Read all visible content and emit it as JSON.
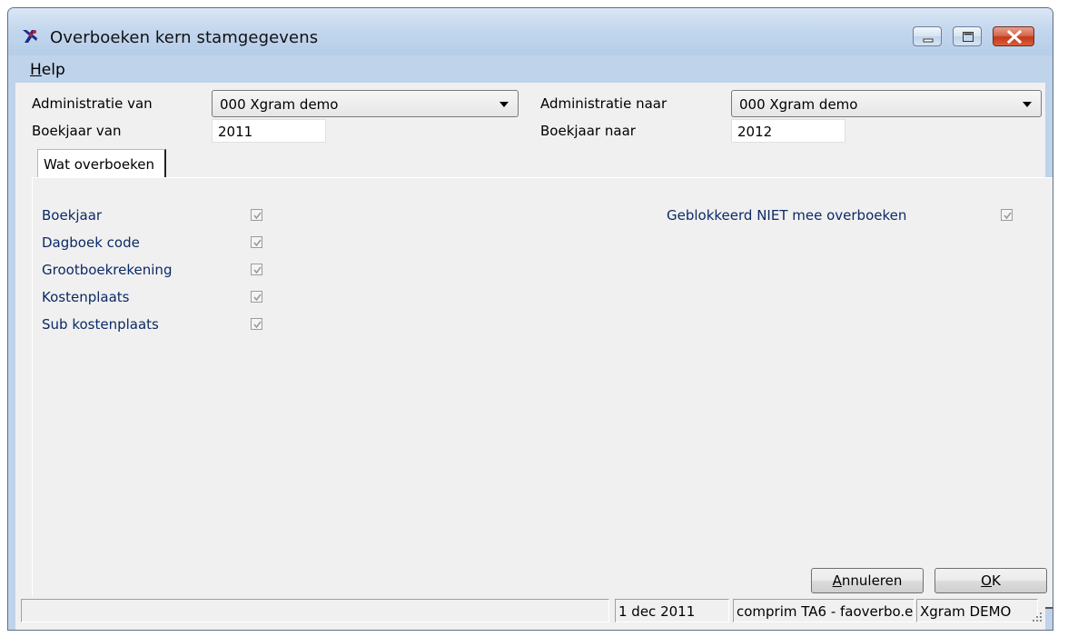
{
  "window": {
    "title": "Overboeken kern stamgegevens",
    "icon": "app-logo-icon"
  },
  "menu": {
    "help_label": "Help",
    "help_mnemonic": "H",
    "help_rest": "elp"
  },
  "form": {
    "admin_from_label": "Administratie van",
    "admin_from_value": "000 Xgram demo",
    "admin_to_label": "Administratie naar",
    "admin_to_value": "000 Xgram demo",
    "year_from_label": "Boekjaar van",
    "year_from_value": "2011",
    "year_to_label": "Boekjaar naar",
    "year_to_value": "2012"
  },
  "tab": {
    "label": "Wat overboeken"
  },
  "options": [
    {
      "label": "Boekjaar",
      "checked": true
    },
    {
      "label": "Dagboek code",
      "checked": true
    },
    {
      "label": "Grootboekrekening",
      "checked": true
    },
    {
      "label": "Kostenplaats",
      "checked": true
    },
    {
      "label": "Sub kostenplaats",
      "checked": true
    }
  ],
  "blocked_option": {
    "label": "Geblokkeerd NIET mee overboeken",
    "checked": true
  },
  "buttons": {
    "cancel_label": "Annuleren",
    "cancel_mnemonic": "A",
    "cancel_rest": "nnuleren",
    "ok_label": "OK",
    "ok_mnemonic": "O",
    "ok_rest": "K"
  },
  "status": {
    "cell1": "",
    "date": "1 dec 2011",
    "program": "comprim TA6 - faoverbo.e",
    "company": "Xgram DEMO"
  },
  "colors": {
    "label_blue": "#0b2a66",
    "frame_blue": "#bfd3ea",
    "close_red": "#c4391b"
  }
}
